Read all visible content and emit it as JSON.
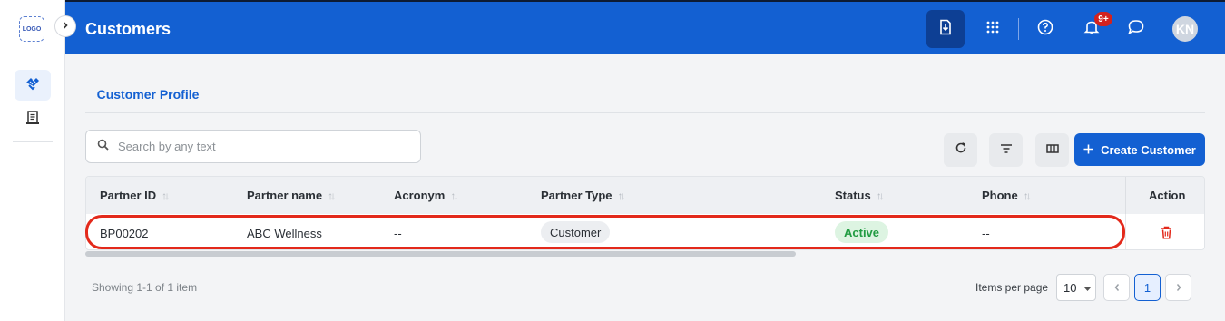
{
  "sidebar": {
    "logo_text": "LOGO",
    "items": [
      {
        "icon": "handshake-icon",
        "active": true
      },
      {
        "icon": "invoice-icon",
        "active": false
      }
    ]
  },
  "header": {
    "title": "Customers",
    "notification_count": "9+",
    "avatar_initials": "KN",
    "brand_color": "#1360d2"
  },
  "tabs": [
    {
      "label": "Customer Profile",
      "active": true
    }
  ],
  "search": {
    "placeholder": "Search by any text",
    "value": ""
  },
  "toolbar": {
    "create_label": "Create Customer"
  },
  "table": {
    "columns": [
      "Partner ID",
      "Partner name",
      "Acronym",
      "Partner Type",
      "Status",
      "Phone",
      "Action"
    ],
    "rows": [
      {
        "partner_id": "BP00202",
        "partner_name": "ABC Wellness",
        "acronym": "--",
        "partner_type": "Customer",
        "status": "Active",
        "phone": "--"
      }
    ]
  },
  "footer": {
    "showing": "Showing 1-1 of 1 item",
    "items_per_page_label": "Items per page",
    "items_per_page": "10",
    "current_page": "1"
  }
}
